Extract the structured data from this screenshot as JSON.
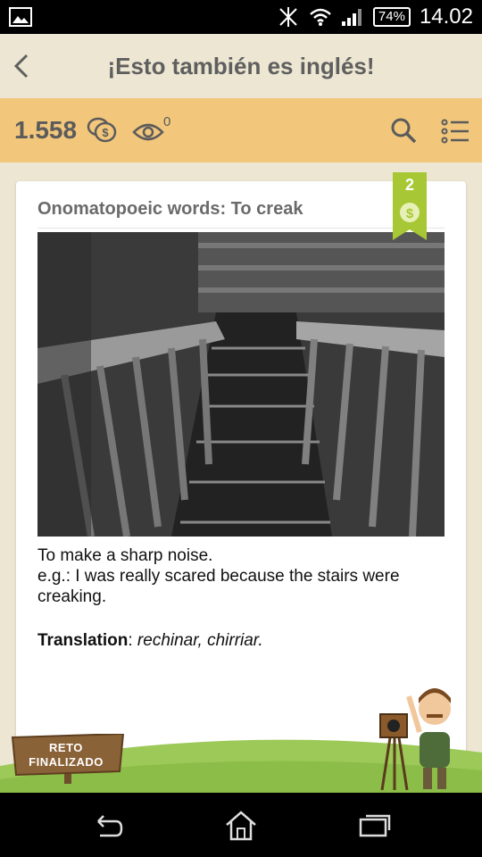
{
  "status_bar": {
    "battery": "74%",
    "time": "14.02"
  },
  "header": {
    "title": "¡Esto también es inglés!"
  },
  "toolbar": {
    "coins": "1.558",
    "views": "0"
  },
  "card": {
    "title": "Onomatopoeic words: To creak",
    "badge_number": "2",
    "definition": "To make a sharp noise.",
    "example": "e.g.: I was really scared because the stairs were creaking.",
    "translation_label": "Translation",
    "translation_value": "rechinar, chirriar."
  },
  "footer": {
    "sign_line1": "RETO",
    "sign_line2": "FINALIZADO"
  },
  "icons": [
    "image-icon",
    "bluetooth-off-icon",
    "wifi-icon",
    "signal-icon",
    "back-arrow-icon",
    "coins-icon",
    "eye-icon",
    "search-icon",
    "list-icon",
    "dollar-icon",
    "nav-back-icon",
    "nav-home-icon",
    "nav-recent-icon"
  ],
  "colors": {
    "toolbar": "#f2c77c",
    "titlebar": "#ede6d2",
    "ribbon": "#a7c834",
    "hill": "#9cc957"
  }
}
